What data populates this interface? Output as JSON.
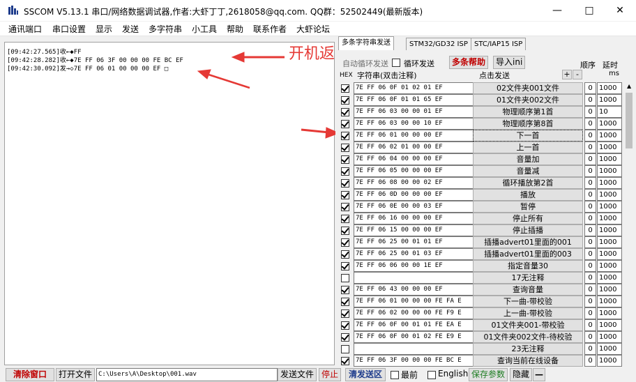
{
  "window": {
    "title": "SSCOM V5.13.1 串口/网络数据调试器,作者:大虾丁丁,2618058@qq.com. QQ群：52502449(最新版本)",
    "minimize": "—",
    "maximize": "□",
    "close": "✕"
  },
  "menu": [
    "通讯端口",
    "串口设置",
    "显示",
    "发送",
    "多字符串",
    "小工具",
    "帮助",
    "联系作者",
    "大虾论坛"
  ],
  "receive": {
    "lines": [
      "[09:42:27.565]收←◆FF",
      "[09:42:28.282]收←◆7E FF 06 3F 00 00 00 FE BC EF",
      "[09:42:30.092]发→◇7E FF 06 01 00 00 00 EF □"
    ],
    "annotation": "开机返回的数据",
    "arrow_color": "#e53935"
  },
  "tabs": [
    "多条字符串发送",
    "STM32/GD32 ISP",
    "STC/IAP15 ISP"
  ],
  "controls": {
    "auto_loop": "自动循环发送",
    "loop_send": "循环发送",
    "multi_help": "多条帮助",
    "import_ini": "导入ini",
    "order": "顺序",
    "delay": "延时"
  },
  "columns": {
    "hex": "HEX",
    "string": "字符串(双击注释)",
    "click_send": "点击发送",
    "plus": "+",
    "minus": "-",
    "ms": "ms"
  },
  "rows": [
    {
      "checked": true,
      "hex": "7E FF 06 0F 01 02 01 EF",
      "label": "02文件夹001文件",
      "order": "0",
      "delay": "1000"
    },
    {
      "checked": true,
      "hex": "7E FF 06 0F 01 01 65 EF",
      "label": "01文件夹002文件",
      "order": "0",
      "delay": "1000"
    },
    {
      "checked": true,
      "hex": "7E FF 06 03 00 00 01 EF",
      "label": "物理顺序第1首",
      "order": "0",
      "delay": "10"
    },
    {
      "checked": true,
      "hex": "7E FF 06 03 00 00 10 EF",
      "label": "物理顺序第8首",
      "order": "0",
      "delay": "1000"
    },
    {
      "checked": true,
      "hex": "7E FF 06 01 00 00 00 EF",
      "label": "下一首",
      "order": "0",
      "delay": "1000"
    },
    {
      "checked": true,
      "hex": "7E FF 06 02 01 00 00 EF",
      "label": "上一首",
      "order": "0",
      "delay": "1000"
    },
    {
      "checked": true,
      "hex": "7E FF 06 04 00 00 00 EF",
      "label": "音量加",
      "order": "0",
      "delay": "1000"
    },
    {
      "checked": true,
      "hex": "7E FF 06 05 00 00 00 EF",
      "label": "音量减",
      "order": "0",
      "delay": "1000"
    },
    {
      "checked": true,
      "hex": "7E FF 06 08 00 00 02 EF",
      "label": "循环播放第2首",
      "order": "0",
      "delay": "1000"
    },
    {
      "checked": true,
      "hex": "7E FF 06 0D 00 00 00 EF",
      "label": "播放",
      "order": "0",
      "delay": "1000"
    },
    {
      "checked": true,
      "hex": "7E FF 06 0E 00 00 03 EF",
      "label": "暂停",
      "order": "0",
      "delay": "1000"
    },
    {
      "checked": true,
      "hex": "7E FF 06 16 00 00 00 EF",
      "label": "停止所有",
      "order": "0",
      "delay": "1000"
    },
    {
      "checked": true,
      "hex": "7E FF 06 15 00 00 00 EF",
      "label": "停止插播",
      "order": "0",
      "delay": "1000"
    },
    {
      "checked": true,
      "hex": "7E FF 06 25 00 01 01 EF",
      "label": "插播advert01里面的001",
      "order": "0",
      "delay": "1000"
    },
    {
      "checked": true,
      "hex": "7E FF 06 25 00 01 03 EF",
      "label": "插播advert01里面的003",
      "order": "0",
      "delay": "1000"
    },
    {
      "checked": true,
      "hex": "7E FF 06 06 00 00 1E EF",
      "label": "指定音量30",
      "order": "0",
      "delay": "1000"
    },
    {
      "checked": false,
      "hex": "",
      "label": "17无注释",
      "order": "0",
      "delay": "1000"
    },
    {
      "checked": true,
      "hex": "7E FF 06 43 00 00 00 EF",
      "label": "查询音量",
      "order": "0",
      "delay": "1000"
    },
    {
      "checked": true,
      "hex": "7E FF 06 01 00 00 00 FE FA E",
      "label": "下一曲-带校验",
      "order": "0",
      "delay": "1000"
    },
    {
      "checked": true,
      "hex": "7E FF 06 02 00 00 00 FE F9 E",
      "label": "上一曲-带校验",
      "order": "0",
      "delay": "1000"
    },
    {
      "checked": true,
      "hex": "7E FF 06 0F 00 01 01 FE EA E",
      "label": "01文件夹001-带校验",
      "order": "0",
      "delay": "1000"
    },
    {
      "checked": true,
      "hex": "7E FF 06 0F 00 01 02 FE E9 E",
      "label": "01文件夹002文件-待校验",
      "order": "0",
      "delay": "1000"
    },
    {
      "checked": false,
      "hex": "",
      "label": "23无注释",
      "order": "0",
      "delay": "1000"
    },
    {
      "checked": true,
      "hex": "7E FF 06 3F 00 00 00 FE BC E",
      "label": "查询当前在线设备",
      "order": "0",
      "delay": "1000"
    }
  ],
  "bottom": {
    "clear_window": "清除窗口",
    "open_file": "打开文件",
    "file_path": "C:\\Users\\A\\Desktop\\001.wav",
    "send_file": "发送文件",
    "stop": "停止",
    "clear_send": "清发送区",
    "front": "最前",
    "english": "English",
    "save_params": "保存参数",
    "hide": "隐藏"
  }
}
